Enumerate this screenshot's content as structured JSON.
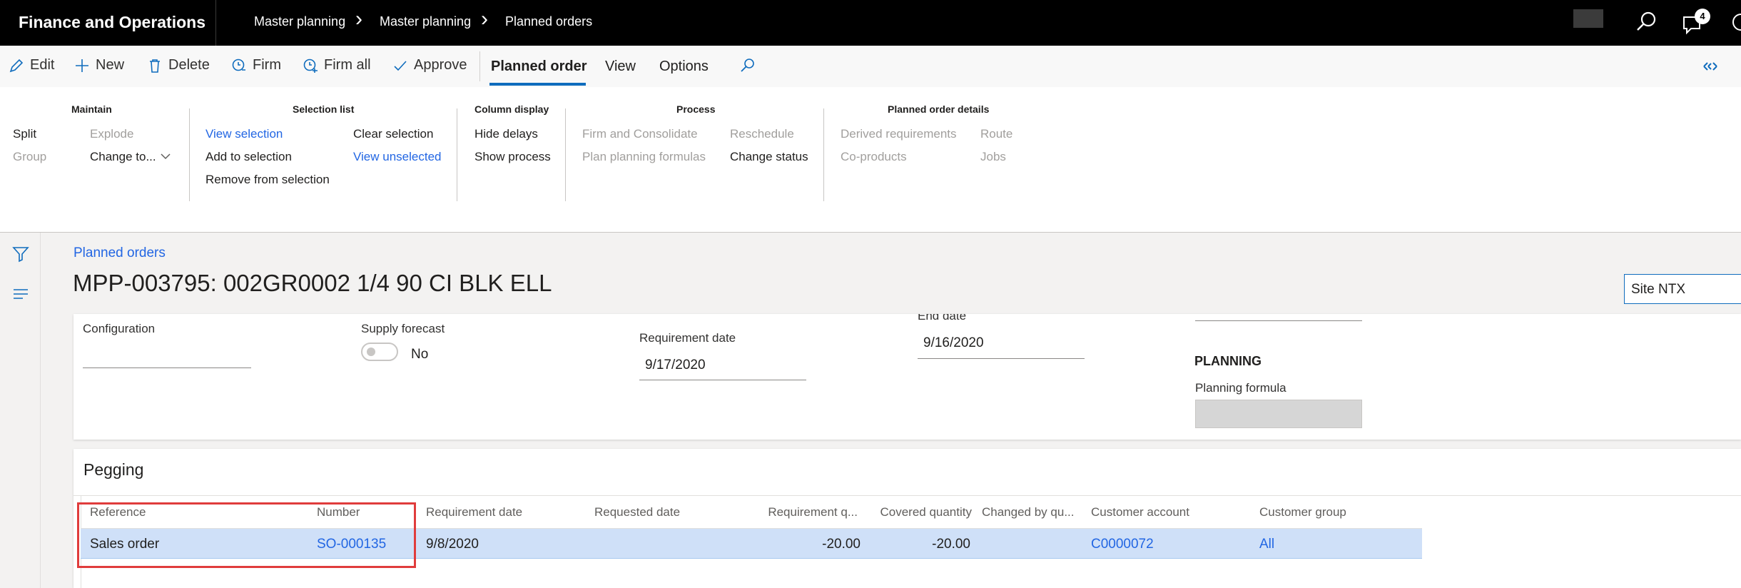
{
  "app": {
    "title": "Finance and Operations"
  },
  "breadcrumbs": [
    "Master planning",
    "Master planning",
    "Planned orders"
  ],
  "notifications": {
    "count": "4"
  },
  "actions": {
    "edit": "Edit",
    "new": "New",
    "delete": "Delete",
    "firm": "Firm",
    "firm_all": "Firm all",
    "approve": "Approve"
  },
  "tabs": [
    "Planned order",
    "View",
    "Options"
  ],
  "ribbon": {
    "maintain": {
      "title": "Maintain",
      "split": "Split",
      "group": "Group",
      "explode": "Explode",
      "change_to": "Change to..."
    },
    "selection": {
      "title": "Selection list",
      "view_selection": "View selection",
      "add_to_selection": "Add to selection",
      "remove_from_selection": "Remove from selection",
      "clear_selection": "Clear selection",
      "view_unselected": "View unselected"
    },
    "column_display": {
      "title": "Column display",
      "hide_delays": "Hide delays",
      "show_process": "Show process"
    },
    "process": {
      "title": "Process",
      "firm_consolidate": "Firm and Consolidate",
      "plan_formulas": "Plan planning formulas",
      "reschedule": "Reschedule",
      "change_status": "Change status"
    },
    "details": {
      "title": "Planned order details",
      "derived": "Derived requirements",
      "coproducts": "Co-products",
      "route": "Route",
      "jobs": "Jobs"
    }
  },
  "page": {
    "breadcrumb": "Planned orders",
    "title": "MPP-003795: 002GR0002 1/4 90 CI BLK ELL",
    "site_filter": "Site NTX"
  },
  "form": {
    "configuration_label": "Configuration",
    "configuration_value": "",
    "supply_forecast_label": "Supply forecast",
    "supply_forecast_value": "No",
    "requirement_date_label": "Requirement date",
    "requirement_date_value": "9/17/2020",
    "end_date_label": "End date",
    "end_date_value": "9/16/2020",
    "planning_section": "PLANNING",
    "planning_formula_label": "Planning formula"
  },
  "pegging": {
    "title": "Pegging",
    "columns": [
      "Reference",
      "Number",
      "Requirement date",
      "Requested date",
      "Requirement q...",
      "Covered quantity",
      "Changed by qu...",
      "Customer account",
      "Customer group"
    ],
    "rows": [
      {
        "reference": "Sales order",
        "number": "SO-000135",
        "requirement_date": "9/8/2020",
        "requested_date": "",
        "requirement_qty": "-20.00",
        "covered_qty": "-20.00",
        "changed_by_qty": "",
        "customer_account": "C0000072",
        "customer_group": "All"
      }
    ]
  },
  "colors": {
    "accent": "#0f6cbd",
    "link": "#2266e3",
    "highlight": "#e03c3c",
    "selected_row": "#cfe0f8"
  }
}
